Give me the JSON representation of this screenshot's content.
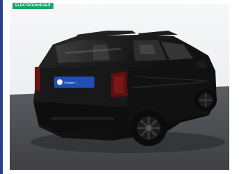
{
  "badge": {
    "text": "ELEKTROFAHRZEIT",
    "color": "#1aa46a"
  },
  "plate": {
    "text": "Stuttgart / ...",
    "color": "#1f4fb4"
  },
  "colors": {
    "car_body": "#141414",
    "floor": "#4a4c50",
    "wall": "#f2f3f4",
    "left_strip": "#2b3f8f"
  }
}
